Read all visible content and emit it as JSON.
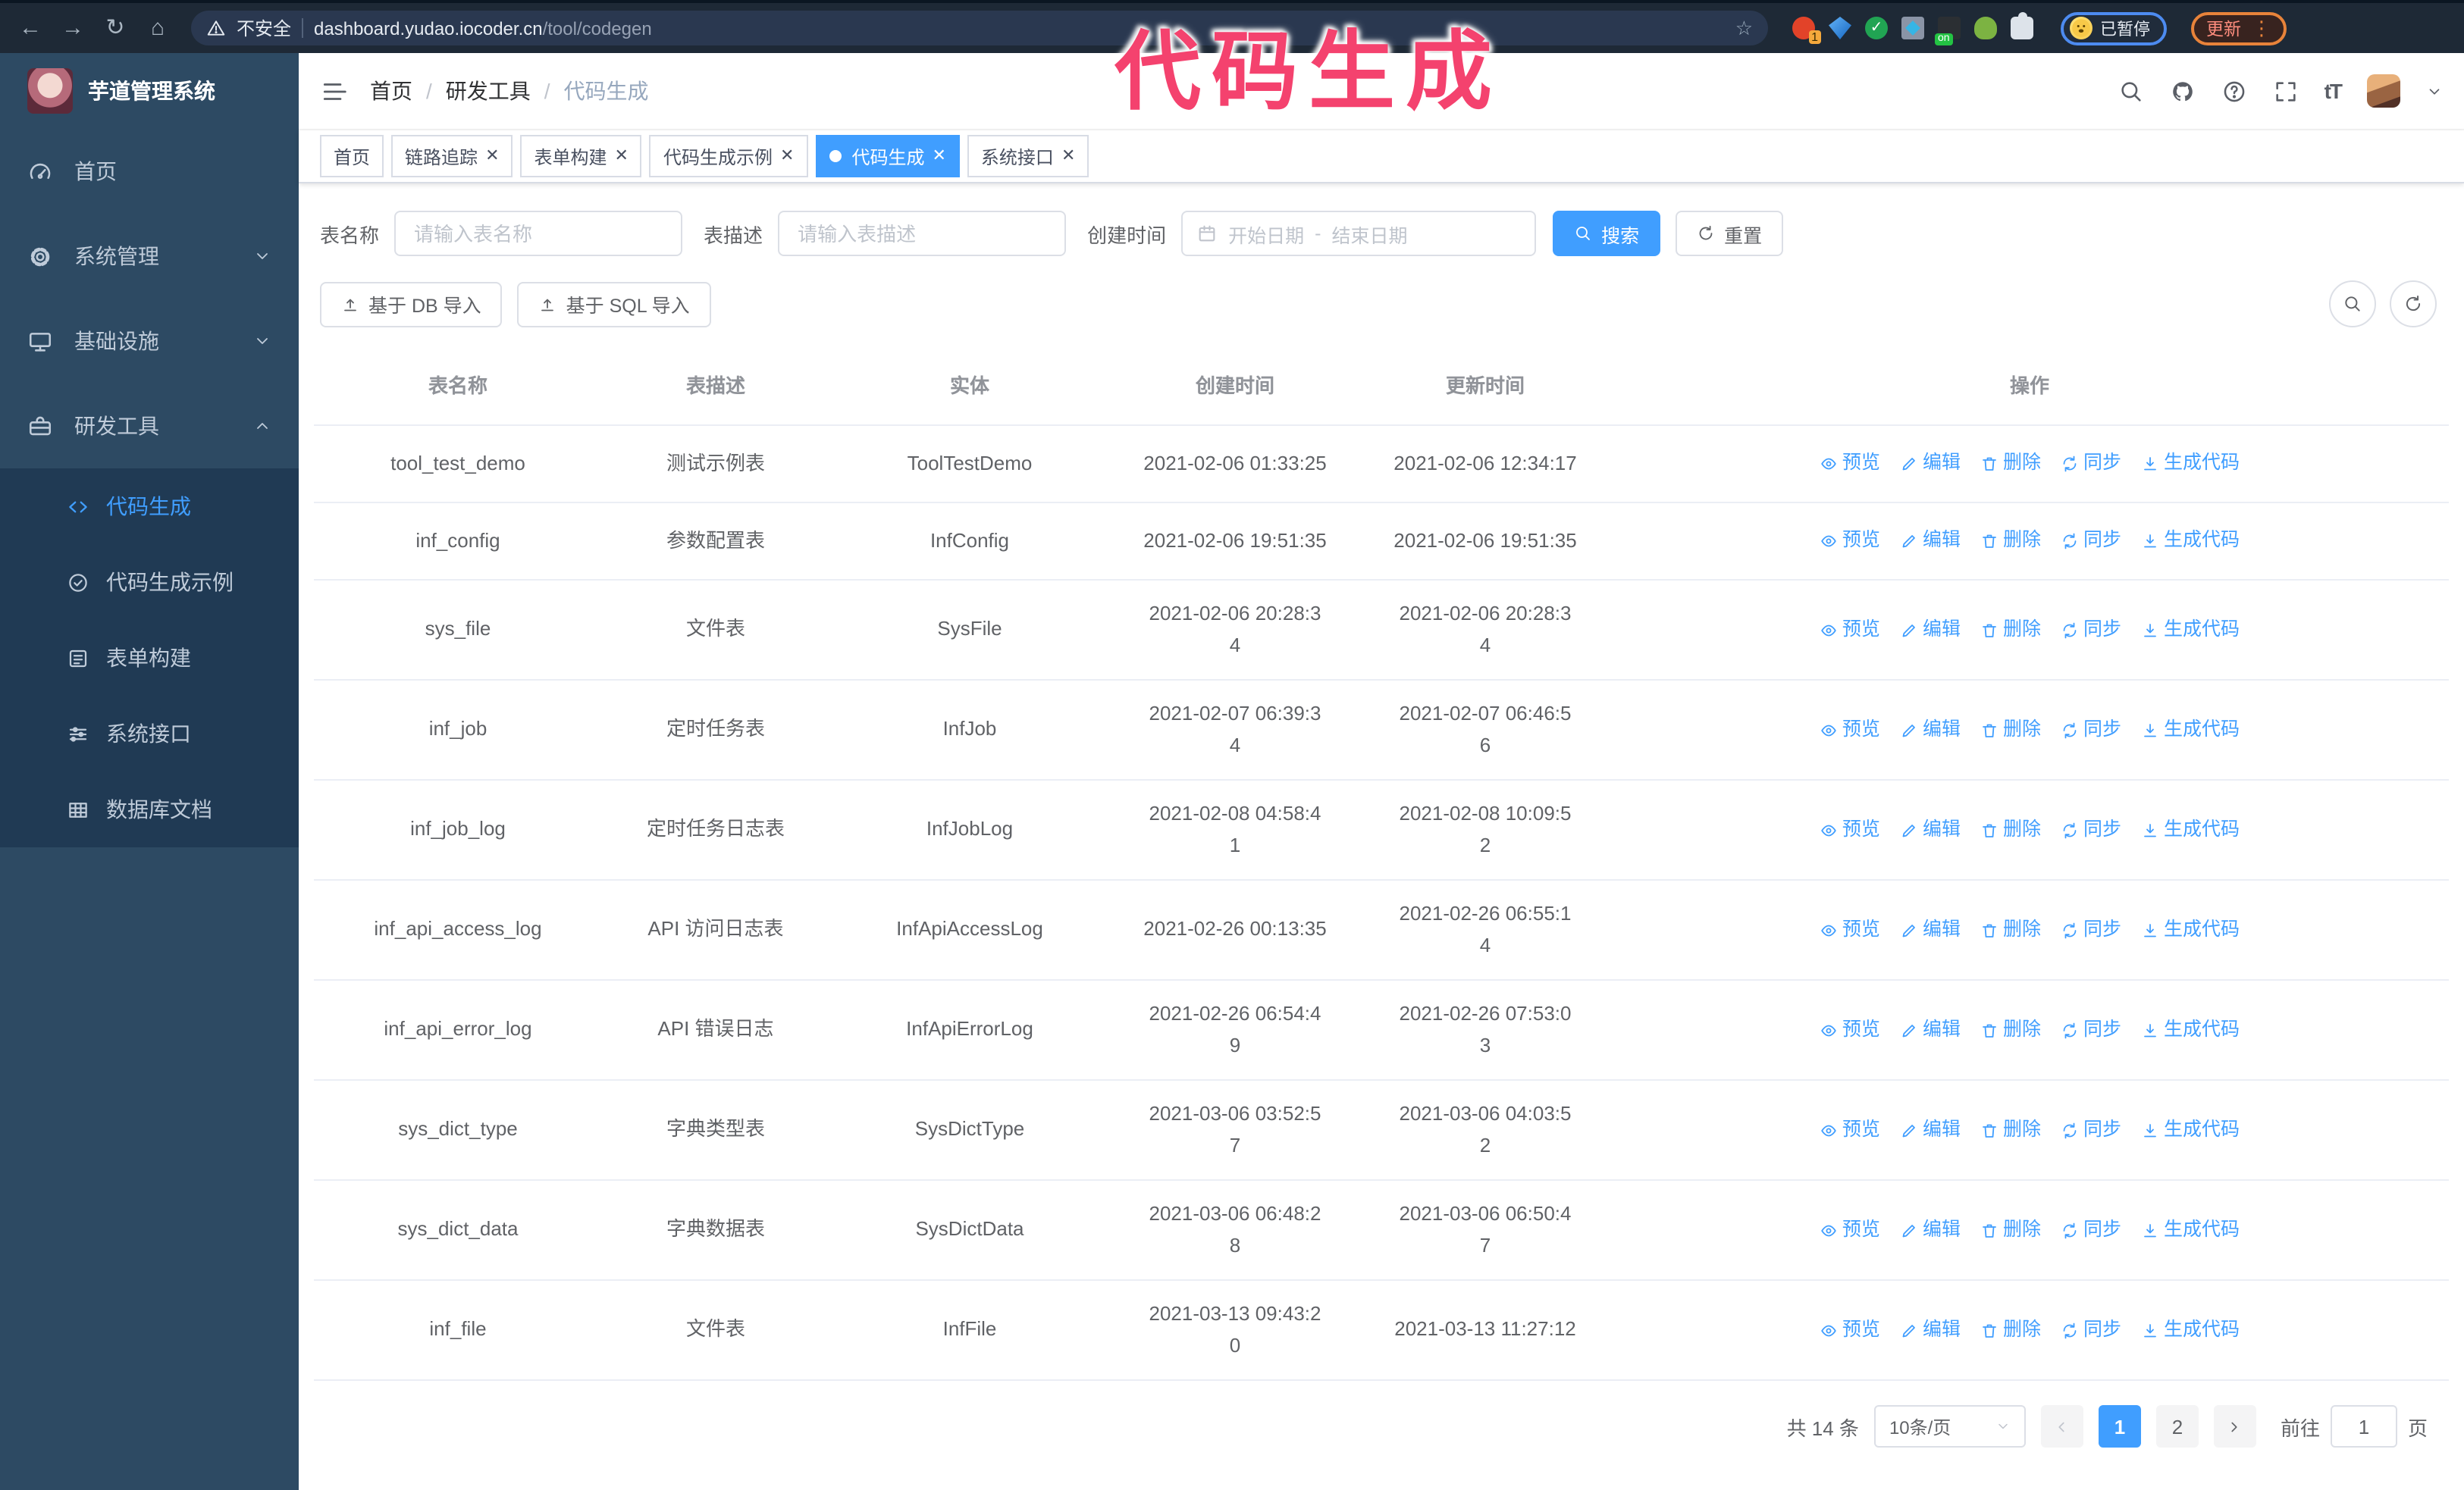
{
  "browser": {
    "security_label": "不安全",
    "url_host": "dashboard.yudao.iocoder.cn",
    "url_path": "/tool/codegen",
    "star_icon": "bookmark-star",
    "profile_label": "已暂停",
    "update_label": "更新"
  },
  "overlay": {
    "text": "代码生成",
    "color": "#f4426e"
  },
  "sidebar": {
    "title": "芋道管理系统",
    "items": [
      {
        "label": "首页",
        "icon": "dashboard-icon"
      },
      {
        "label": "系统管理",
        "icon": "gear-icon",
        "chevron": "down"
      },
      {
        "label": "基础设施",
        "icon": "monitor-icon",
        "chevron": "down"
      },
      {
        "label": "研发工具",
        "icon": "toolbox-icon",
        "chevron": "up",
        "children": [
          {
            "label": "代码生成",
            "icon": "code-icon",
            "active": true
          },
          {
            "label": "代码生成示例",
            "icon": "badge-check-icon",
            "active": false
          },
          {
            "label": "表单构建",
            "icon": "form-icon",
            "active": false
          },
          {
            "label": "系统接口",
            "icon": "sliders-icon",
            "active": false
          },
          {
            "label": "数据库文档",
            "icon": "db-grid-icon",
            "active": false
          }
        ]
      }
    ]
  },
  "header": {
    "breadcrumb": [
      "首页",
      "研发工具",
      "代码生成"
    ]
  },
  "tabs": [
    {
      "label": "首页",
      "closable": false,
      "active": false
    },
    {
      "label": "链路追踪",
      "closable": true,
      "active": false
    },
    {
      "label": "表单构建",
      "closable": true,
      "active": false
    },
    {
      "label": "代码生成示例",
      "closable": true,
      "active": false
    },
    {
      "label": "代码生成",
      "closable": true,
      "active": true
    },
    {
      "label": "系统接口",
      "closable": true,
      "active": false
    }
  ],
  "search_form": {
    "name_label": "表名称",
    "name_placeholder": "请输入表名称",
    "desc_label": "表描述",
    "desc_placeholder": "请输入表描述",
    "date_label": "创建时间",
    "date_start_placeholder": "开始日期",
    "date_separator": "-",
    "date_end_placeholder": "结束日期",
    "search_label": "搜索",
    "reset_label": "重置"
  },
  "toolbar": {
    "import_db_label": "基于 DB 导入",
    "import_sql_label": "基于 SQL 导入"
  },
  "table": {
    "columns": [
      "表名称",
      "表描述",
      "实体",
      "创建时间",
      "更新时间",
      "操作"
    ],
    "row_actions": [
      "预览",
      "编辑",
      "删除",
      "同步",
      "生成代码"
    ],
    "rows": [
      {
        "name": "tool_test_demo",
        "desc": "测试示例表",
        "entity": "ToolTestDemo",
        "created": [
          "2021-02-06 01:33:25"
        ],
        "updated": [
          "2021-02-06 12:34:17"
        ]
      },
      {
        "name": "inf_config",
        "desc": "参数配置表",
        "entity": "InfConfig",
        "created": [
          "2021-02-06 19:51:35"
        ],
        "updated": [
          "2021-02-06 19:51:35"
        ]
      },
      {
        "name": "sys_file",
        "desc": "文件表",
        "entity": "SysFile",
        "created": [
          "2021-02-06 20:28:3",
          "4"
        ],
        "updated": [
          "2021-02-06 20:28:3",
          "4"
        ]
      },
      {
        "name": "inf_job",
        "desc": "定时任务表",
        "entity": "InfJob",
        "created": [
          "2021-02-07 06:39:3",
          "4"
        ],
        "updated": [
          "2021-02-07 06:46:5",
          "6"
        ]
      },
      {
        "name": "inf_job_log",
        "desc": "定时任务日志表",
        "entity": "InfJobLog",
        "created": [
          "2021-02-08 04:58:4",
          "1"
        ],
        "updated": [
          "2021-02-08 10:09:5",
          "2"
        ]
      },
      {
        "name": "inf_api_access_log",
        "desc": "API 访问日志表",
        "entity": "InfApiAccessLog",
        "created": [
          "2021-02-26 00:13:35"
        ],
        "updated": [
          "2021-02-26 06:55:1",
          "4"
        ]
      },
      {
        "name": "inf_api_error_log",
        "desc": "API 错误日志",
        "entity": "InfApiErrorLog",
        "created": [
          "2021-02-26 06:54:4",
          "9"
        ],
        "updated": [
          "2021-02-26 07:53:0",
          "3"
        ]
      },
      {
        "name": "sys_dict_type",
        "desc": "字典类型表",
        "entity": "SysDictType",
        "created": [
          "2021-03-06 03:52:5",
          "7"
        ],
        "updated": [
          "2021-03-06 04:03:5",
          "2"
        ]
      },
      {
        "name": "sys_dict_data",
        "desc": "字典数据表",
        "entity": "SysDictData",
        "created": [
          "2021-03-06 06:48:2",
          "8"
        ],
        "updated": [
          "2021-03-06 06:50:4",
          "7"
        ]
      },
      {
        "name": "inf_file",
        "desc": "文件表",
        "entity": "InfFile",
        "created": [
          "2021-03-13 09:43:2",
          "0"
        ],
        "updated": [
          "2021-03-13 11:27:12"
        ]
      }
    ]
  },
  "pagination": {
    "total_label": "共 14 条",
    "page_size_label": "10条/页",
    "pages": [
      "1",
      "2"
    ],
    "active_page": "1",
    "goto_label": "前往",
    "goto_value": "1",
    "goto_suffix": "页"
  },
  "colors": {
    "accent": "#409eff",
    "sidebar": "#2d4a63",
    "submenu": "#203a54",
    "overlay_pink": "#f4426e"
  }
}
